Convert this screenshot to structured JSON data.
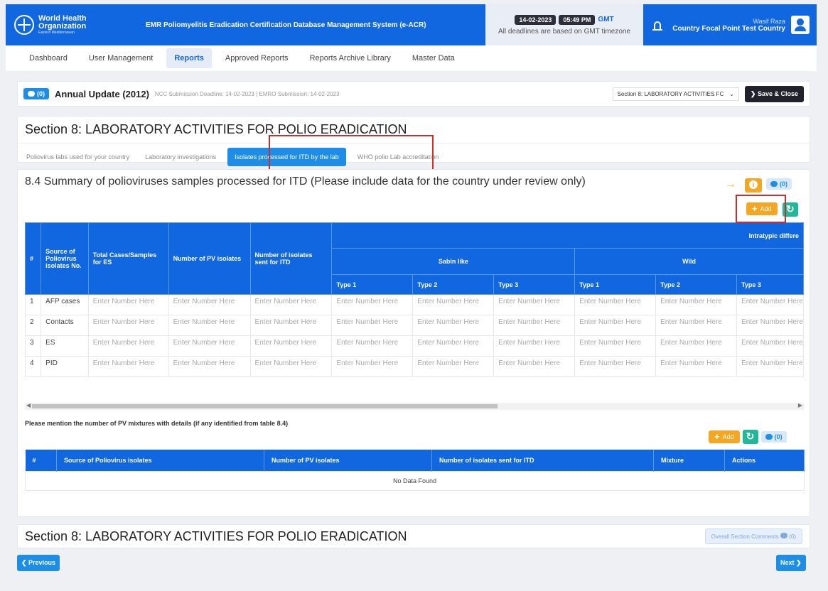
{
  "header": {
    "org_name": "World Health",
    "org_name2": "Organization",
    "org_region": "Eastern Mediterranean",
    "app_title": "EMR Poliomyelitis Eradication Certification Database Management System (e-ACR)",
    "date": "14-02-2023",
    "time": "05:49 PM",
    "tz": "GMT",
    "deadline_note": "All deadlines are based on GMT timezone",
    "user_name": "Wasif Raza",
    "user_role": "Country Focal Point Test Country"
  },
  "nav": {
    "items": [
      "Dashboard",
      "User Management",
      "Reports",
      "Approved Reports",
      "Reports Archive Library",
      "Master Data"
    ],
    "active": "Reports"
  },
  "annual": {
    "comments": "(0)",
    "title": "Annual Update (2012)",
    "deadline": "NCC Submission Deadline: 14-02-2023 | EMRO Submission: 14-02-2023",
    "section_select": "Section 8: LABORATORY ACTIVITIES FC",
    "save_label": "Save & Close"
  },
  "section": {
    "title": "Section 8: LABORATORY ACTIVITIES FOR POLIO ERADICATION",
    "tabs": [
      "Poliovirus labs used for your country",
      "Laboratory investigations",
      "Isolates processed for ITD by the lab",
      "WHO polio Lab accreditation"
    ]
  },
  "main": {
    "title": "8.4 Summary of polioviruses samples processed for ITD (Please include data for the country under review only)",
    "comments": "(0)",
    "add_label": "Add",
    "table": {
      "h_num": "#",
      "h_source": "Source of Poliovirus isolates No.",
      "h_total": "Total Cases/Samples for ES",
      "h_pv": "Number of PV isolates",
      "h_sent": "Number of isolates sent for ITD",
      "h_itd": "Intratypic differe",
      "h_sabin": "Sabin like",
      "h_wild": "Wild",
      "types": [
        "Type 1",
        "Type 2",
        "Type 3",
        "Type 1",
        "Type 2",
        "Type 3"
      ],
      "placeholder": "Enter Number Here",
      "rows": [
        {
          "num": "1",
          "source": "AFP cases"
        },
        {
          "num": "2",
          "source": "Contacts"
        },
        {
          "num": "3",
          "source": "ES"
        },
        {
          "num": "4",
          "source": "PID"
        }
      ]
    }
  },
  "mixtures": {
    "title": "Please mention the number of PV mixtures with details (if any identified from table 8.4)",
    "add_label": "Add",
    "comments": "(0)",
    "headers": [
      "#",
      "Source of Poliovirus isolates",
      "Number of PV isolates",
      "Number of isolates sent for ITD",
      "Mixture",
      "Actions"
    ],
    "empty": "No Data Found"
  },
  "footer": {
    "title": "Section 8: LABORATORY ACTIVITIES FOR POLIO ERADICATION",
    "overall_comments": "Overall Section Comments",
    "overall_count": "(0)",
    "prev": "Previous",
    "next": "Next"
  },
  "colors": {
    "primary": "#1167e0",
    "accent": "#1d8de8",
    "warning": "#f5a623",
    "success": "#20b89a",
    "highlight": "#c9302c"
  }
}
